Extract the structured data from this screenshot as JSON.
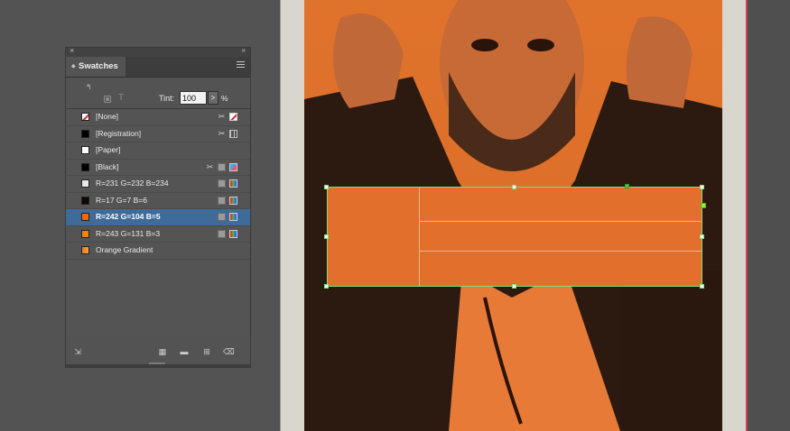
{
  "panel": {
    "tab_label": "Swatches",
    "close_glyph": "×",
    "collapse_glyph": "»",
    "tint_label": "Tint:",
    "tint_value": "100",
    "tint_arrow": ">",
    "tint_unit": "%",
    "text_glyph": "T",
    "swatches": [
      {
        "name": "[None]",
        "color": "#ffffff",
        "kind": "none"
      },
      {
        "name": "[Registration]",
        "color": "#000000",
        "kind": "registration"
      },
      {
        "name": "[Paper]",
        "color": "#ffffff",
        "kind": "paper"
      },
      {
        "name": "[Black]",
        "color": "#000000",
        "kind": "black"
      },
      {
        "name": "R=231 G=232 B=234",
        "color": "#e7e8ea",
        "kind": "rgb"
      },
      {
        "name": "R=17 G=7 B=6",
        "color": "#110706",
        "kind": "rgb"
      },
      {
        "name": "R=242 G=104 B=5",
        "color": "#f26805",
        "kind": "rgb",
        "selected": true
      },
      {
        "name": "R=243 G=131 B=3",
        "color": "#f38303",
        "kind": "rgb"
      },
      {
        "name": "Orange Gradient",
        "color": "#ef7a1a",
        "kind": "gradient"
      }
    ],
    "footer_icons": [
      "new-color-group-icon",
      "swatch-options-icon",
      "folder-icon",
      "new-swatch-icon",
      "trash-icon"
    ]
  },
  "colors": {
    "selection_blue": "#3f6b99",
    "frame_orange": "#e2702c",
    "selection_green": "#7ee07e"
  }
}
